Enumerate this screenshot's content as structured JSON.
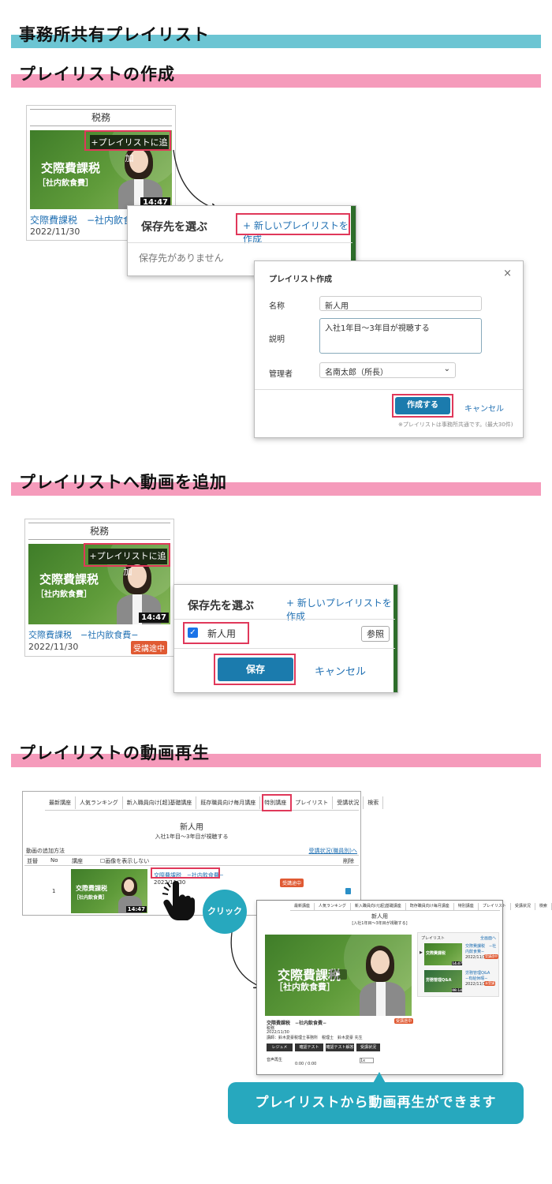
{
  "page": {
    "title": "事務所共有プレイリスト",
    "sections": [
      {
        "heading": "プレイリストの作成"
      },
      {
        "heading": "プレイリストへ動画を追加"
      },
      {
        "heading": "プレイリストの動画再生"
      }
    ]
  },
  "colors": {
    "teal": "#6cc5d3",
    "pink": "#f59bbb",
    "accent_red": "#e0385a",
    "button_blue": "#1b7bad",
    "callout_teal": "#27a8be"
  },
  "card": {
    "category": "税務",
    "add_to_playlist": "+プレイリストに追加",
    "thumb_title": "交際費課税",
    "thumb_sub": "［社内飲食費］",
    "duration": "14:47",
    "video_title": "交際費課税　−社内飲食費−",
    "video_title_short": "交際費課税　−社内飲食",
    "date": "2022/11/30",
    "status_badge": "受講途中"
  },
  "save_dialog": {
    "title": "保存先を選ぶ",
    "new_playlist": "+ 新しいプレイリストを作成",
    "empty": "保存先がありません"
  },
  "create_dialog": {
    "title": "プレイリスト作成",
    "close": "×",
    "name_label": "名称",
    "name_value": "新人用",
    "desc_label": "説明",
    "desc_value": "入社1年目～3年目が視聴する",
    "admin_label": "管理者",
    "admin_value": "名南太郎（所長）",
    "create_button": "作成する",
    "cancel": "キャンセル",
    "note": "※プレイリストは事務所共通です。(最大30件)"
  },
  "save_dialog2": {
    "title": "保存先を選ぶ",
    "new_playlist": "+ 新しいプレイリストを作成",
    "item": "新人用",
    "ref": "参照",
    "save": "保存",
    "cancel": "キャンセル"
  },
  "playlist_page": {
    "tabs": [
      "最新講座",
      "人気ランキング",
      "新入職員向け[超]基礎講座",
      "既存職員向け毎月講座",
      "特別講座",
      "プレイリスト",
      "受講状況",
      "検索"
    ],
    "name": "新人用",
    "desc": "入社1年目～3年目が視聴する",
    "add_method": "動画の追加方法",
    "status_link": "受講状況(職員別)へ",
    "col_order": "並替",
    "col_no": "No",
    "col_course": "講座",
    "hide_images": "画像を表示しない",
    "col_delete": "削除",
    "row_no": "1",
    "row_title": "交際費課税　−社内飲食費−",
    "row_date": "2022/11/30",
    "row_badge": "受講途中",
    "click": "クリック"
  },
  "player_page": {
    "playlist_label": "プレイリスト",
    "sub_top": "新人用",
    "desc_top": "[入社1年目～3年目が視聴する]",
    "hide": "全画面へ",
    "video_title": "交際費課税　−社内飲食費−",
    "category": "税務",
    "date": "2022/11/30",
    "lecturer": "講師：鈴木愛豪税理士事務所　税理士　鈴木愛豪 先生",
    "btns": [
      "レジュメ",
      "確認テスト",
      "確認テスト解答",
      "受講状況"
    ],
    "audio": "音声再生",
    "time": "0:00 / 0:00",
    "speed": "1x",
    "side_items": [
      {
        "title": "交際費課税　−社内飲食費−",
        "date": "2022/11/30",
        "badge": "受講途中"
      },
      {
        "title": "労務管理Q&A　−有給休暇−",
        "date": "2022/11/30",
        "badge": "未受講"
      }
    ],
    "side_thumb2": "労務管理Q&A",
    "side_dur1": "14:47",
    "side_dur2": "08:14"
  },
  "callout": "プレイリストから動画再生ができます"
}
